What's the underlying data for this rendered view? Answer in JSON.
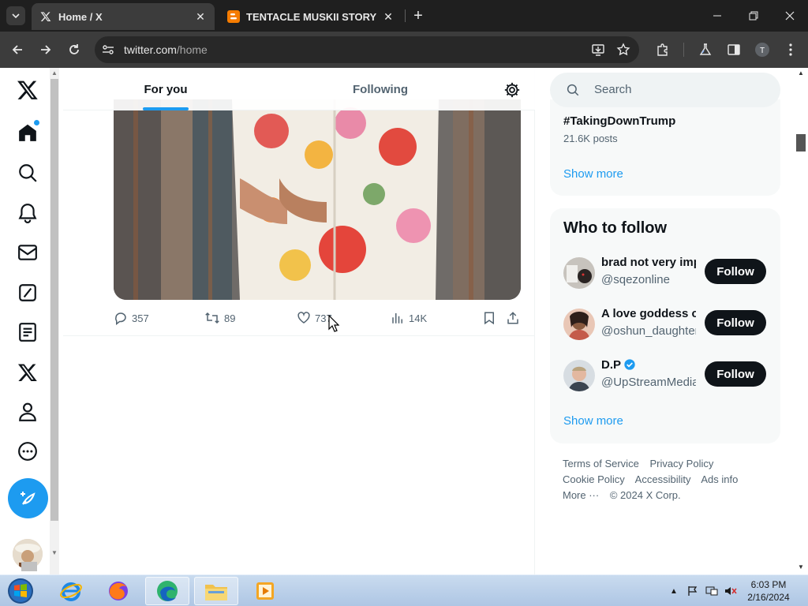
{
  "browser": {
    "tabs": [
      {
        "title": "Home / X",
        "active": true,
        "favicon": "x-logo-icon"
      },
      {
        "title": "TENTACLE MUSKII STORY",
        "active": false,
        "favicon": "blogger-icon"
      }
    ],
    "url_host": "twitter.com",
    "url_path": "/home"
  },
  "nav": {
    "items": [
      "x-logo",
      "home",
      "explore",
      "notifications",
      "messages",
      "grok",
      "lists",
      "premium",
      "profile",
      "more"
    ]
  },
  "feed": {
    "tabs": [
      {
        "label": "For you",
        "active": true
      },
      {
        "label": "Following",
        "active": false
      }
    ],
    "tweet": {
      "replies": "357",
      "reposts": "89",
      "likes": "737",
      "views": "14K"
    }
  },
  "right": {
    "search_placeholder": "Search",
    "trend": {
      "name": "#TakingDownTrump",
      "count": "21.6K posts"
    },
    "show_more": "Show more",
    "who_to_follow": {
      "title": "Who to follow",
      "users": [
        {
          "name": "brad not very important",
          "handle": "@sqezonline",
          "verified": false,
          "button": "Follow"
        },
        {
          "name": "A love goddess c",
          "handle": "@oshun_daughter",
          "verified": false,
          "button": "Follow"
        },
        {
          "name": "D.P",
          "handle": "@UpStreamMedia",
          "verified": true,
          "button": "Follow"
        }
      ],
      "show_more": "Show more"
    },
    "footer": {
      "links": [
        "Terms of Service",
        "Privacy Policy",
        "Cookie Policy",
        "Accessibility",
        "Ads info",
        "More ···"
      ],
      "copyright": "© 2024 X Corp."
    }
  },
  "taskbar": {
    "time": "6:03 PM",
    "date": "2/16/2024"
  },
  "colors": {
    "accent": "#1d9bf0",
    "text": "#0f1419",
    "muted": "#536471"
  }
}
